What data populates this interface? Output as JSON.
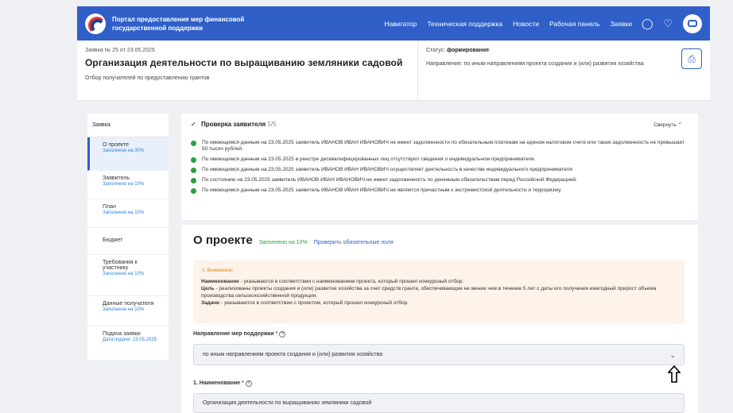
{
  "topbar": {
    "portal_title": "Портал предоставления мер финансовой государственной поддержки",
    "nav": [
      "Навигатор",
      "Техническая поддержка",
      "Новости",
      "Рабочая панель",
      "Заявки"
    ],
    "accent": "#2f5fc7"
  },
  "header": {
    "request_number": "Заявка № 25 от 23.05.2025",
    "title": "Организация деятельности по выращиванию земляники садовой",
    "subtitle": "Отбор получателей по предоставлению грантов",
    "status_label": "Статус:",
    "status_value": "формирование",
    "direction": "Направление: по иным направлениям проекта создания и (или) развития хозяйства"
  },
  "sidebar": {
    "head": "Заявка",
    "items": [
      {
        "label": "О проекте",
        "sub": "Заполнено на 30%"
      },
      {
        "label": "Заявитель",
        "sub": "Заполнено на 10%"
      },
      {
        "label": "План",
        "sub": "Заполнено на 10%"
      },
      {
        "label": "Бюджет",
        "sub": ""
      },
      {
        "label": "Требования к участнику",
        "sub": "Заполнено на 10%"
      },
      {
        "label": "Данные получателя",
        "sub": "Заполнено на 10%"
      },
      {
        "label": "Подача заявки",
        "sub": "Дата подачи: 23.05.2025"
      }
    ]
  },
  "verify": {
    "title": "Проверка заявителя",
    "count": "5/5",
    "collapse": "Свернуть",
    "checks": [
      "По имеющимся данным на 23.05.2025 заявитель ИВАНОВ ИВАН ИВАНОВИЧ не имеет задолженности по обязательным платежам на едином налоговом счете или такая задолженность не превышает 50 тысяч рублей.",
      "По имеющимся данным на 23.05.2025 в реестре дисквалифицированных лиц отсутствуют сведения о индивидуальном предпринимателе.",
      "По имеющимся данным на 23.05.2025 заявитель ИВАНОВ ИВАН ИВАНОВИЧ осуществляет деятельность в качестве индивидуального предпринимателя",
      "По состоянию на 23.05.2025 заявитель ИВАНОВ ИВАН ИВАНОВИЧ не имеет задолженность по денежным обязательствам перед Российской Федерацией.",
      "По имеющимся данным на 23.05.2025 заявитель ИВАНОВ ИВАН ИВАНОВИЧ не является причастным к экстремистской деятельности и терроризму."
    ]
  },
  "about": {
    "title": "О проекте",
    "filled": "Заполнено на 10%",
    "check_link": "Проверить обязательные поля",
    "warning_title": "Внимание!",
    "warning_lines": [
      {
        "bold": "Наименование",
        "text": " - указывается в соответствии с наименованием проекта, который прошел конкурсный отбор."
      },
      {
        "bold": "Цель",
        "text": " - реализованы проекты создания и (или) развития хозяйства за счет средств гранта, обеспечивающие не менее чем в течение 5 лет с даты его получения ежегодный прирост объема производства сельскохозяйственной продукции."
      },
      {
        "bold": "Задачи",
        "text": " - указываются в соответствии с проектом, который прошел конкурсный отбор."
      }
    ],
    "support_label": "Направление мер поддержки",
    "support_value": "по иным направлениям проекта создания и (или) развития хозяйства",
    "name_label": "1. Наименование",
    "name_value": "Организация деятельности по выращиванию земляники садовой"
  }
}
